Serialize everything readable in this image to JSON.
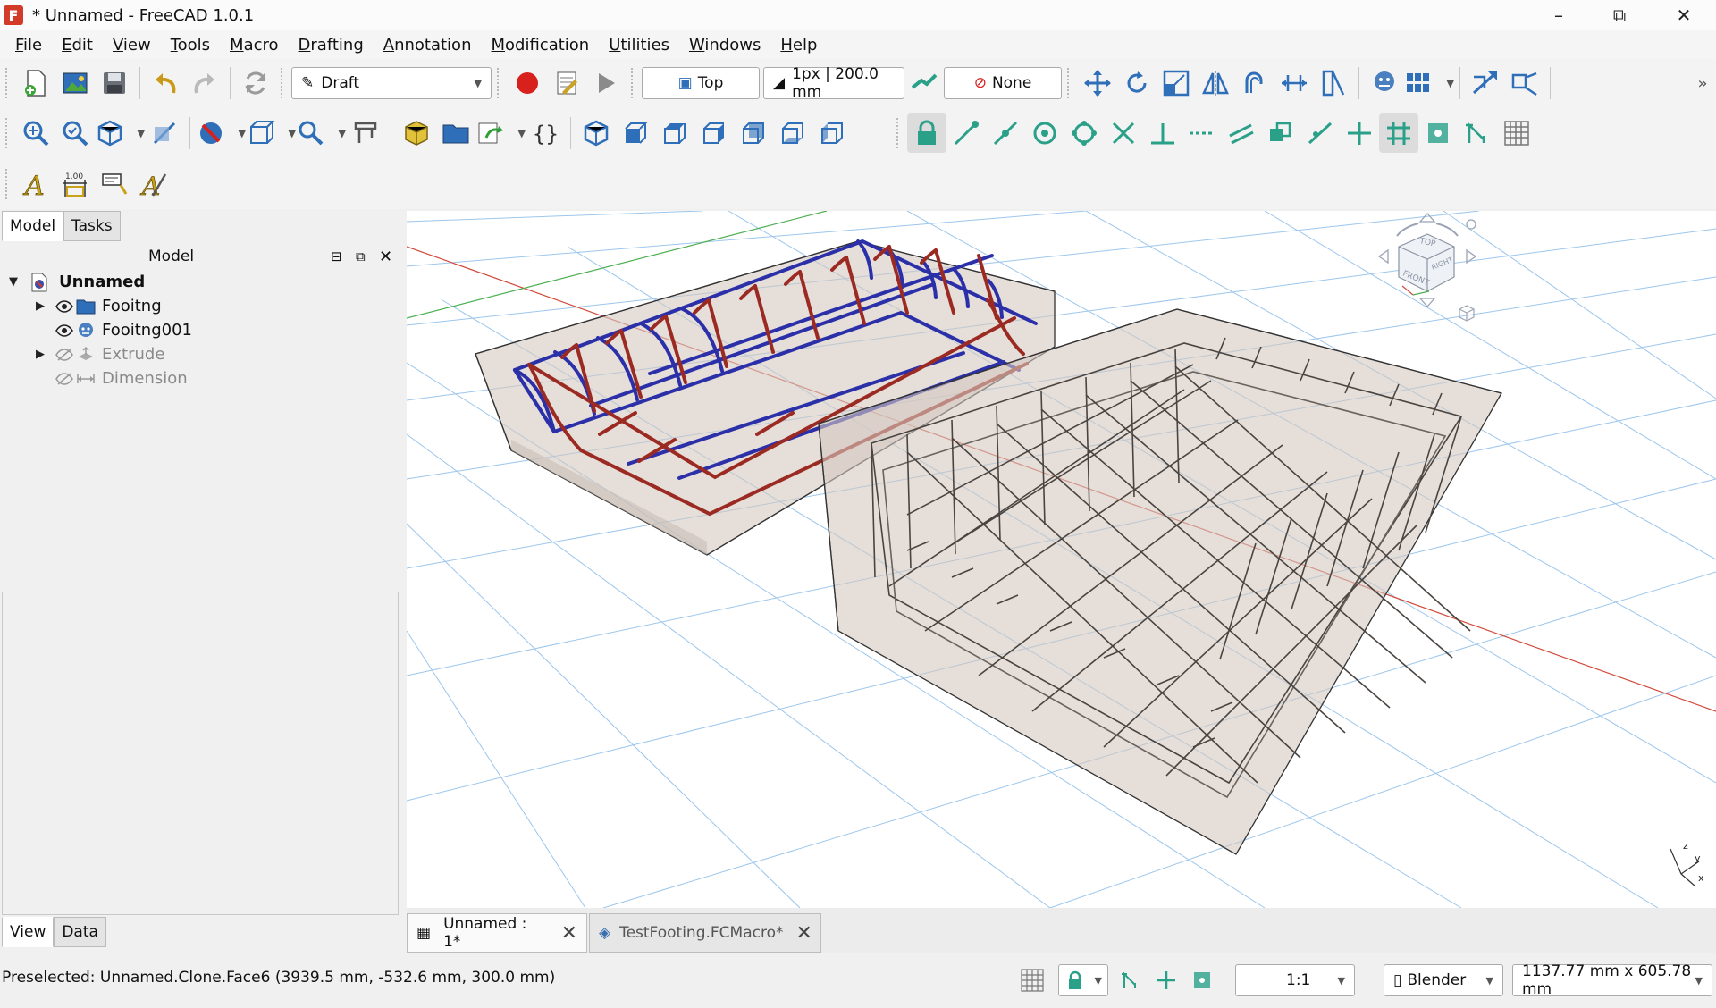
{
  "window": {
    "title": "* Unnamed - FreeCAD 1.0.1",
    "logo_letter": "F"
  },
  "menu": [
    "File",
    "Edit",
    "View",
    "Tools",
    "Macro",
    "Drafting",
    "Annotation",
    "Modification",
    "Utilities",
    "Windows",
    "Help"
  ],
  "toolbar": {
    "workbench": "Draft",
    "working_plane": "Top",
    "style": "1px | 200.0 mm",
    "construction": "None"
  },
  "left_panel": {
    "tabs": [
      "Model",
      "Tasks"
    ],
    "tree_header": "Model",
    "tree": [
      {
        "label": "Unnamed",
        "expanded": true,
        "visible": true,
        "icon": "document-icon"
      },
      {
        "label": "Fooitng",
        "expanded": false,
        "visible": true,
        "icon": "folder-icon"
      },
      {
        "label": "Fooitng001",
        "expanded": false,
        "visible": true,
        "icon": "clone-icon"
      },
      {
        "label": "Extrude",
        "expanded": false,
        "visible": false,
        "icon": "extrude-icon"
      },
      {
        "label": "Dimension",
        "expanded": false,
        "visible": false,
        "icon": "dimension-icon"
      }
    ],
    "bottom_tabs": [
      "View",
      "Data"
    ]
  },
  "doc_tabs": [
    {
      "label": "Unnamed : 1*",
      "active": true
    },
    {
      "label": "TestFooting.FCMacro*",
      "active": false
    }
  ],
  "navcube": {
    "top": "TOP",
    "front": "FRONT",
    "right": "RIGHT"
  },
  "axis": {
    "x": "x",
    "y": "y",
    "z": "z"
  },
  "status": {
    "message": "Preselected: Unnamed.Clone.Face6 (3939.5 mm, -532.6 mm, 300.0 mm)",
    "scale": "1:1",
    "nav_style": "Blender",
    "dimensions": "1137.77 mm x 605.78 mm"
  },
  "colors": {
    "accent_red": "#d23a2a",
    "rebar_red": "#9b2a22",
    "rebar_blue": "#2b2fa8",
    "concrete": "#d3c8c0"
  }
}
